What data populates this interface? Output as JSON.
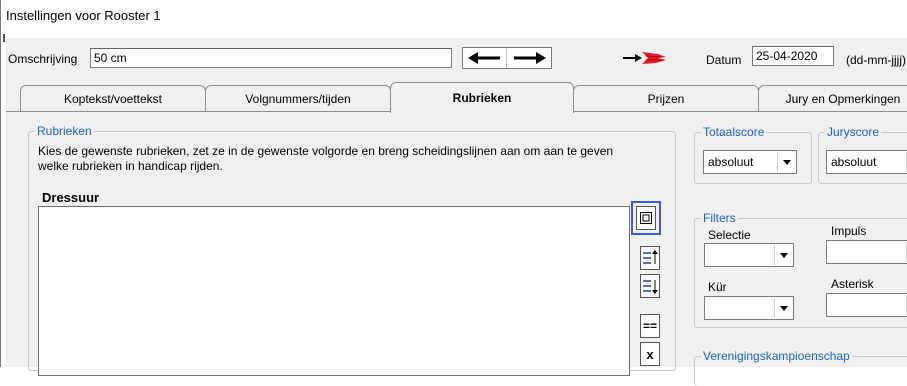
{
  "window": {
    "title": "Instellingen voor Rooster 1"
  },
  "header": {
    "omschrijving_label": "Omschrijving",
    "omschrijving_value": "50 cm",
    "datum_label": "Datum",
    "datum_value": "25-04-2020",
    "datum_format": "(dd-mm-jjjj)"
  },
  "tabs": [
    {
      "label": "Koptekst/voettekst"
    },
    {
      "label": "Volgnummers/tijden"
    },
    {
      "label": "Rubrieken",
      "active": true
    },
    {
      "label": "Prijzen"
    },
    {
      "label": "Jury en Opmerkingen"
    }
  ],
  "rubrieken": {
    "group_title": "Rubrieken",
    "description_line1": "Kies de gewenste rubrieken, zet ze in de gewenste volgorde en breng scheidingslijnen aan om aan te geven",
    "description_line2": "welke rubrieken in handicap rijden.",
    "list_title": "Dressuur",
    "items": []
  },
  "totaalscore": {
    "title": "Totaalscore",
    "value": "absoluut"
  },
  "juryscore": {
    "title": "Juryscore",
    "value": "absoluut"
  },
  "filters": {
    "title": "Filters",
    "selectie_label": "Selectie",
    "selectie_value": "",
    "impuls_label": "Impuls",
    "impuls_value": "",
    "kur_label": "Kür",
    "kur_value": "",
    "asterisk_label": "Asterisk",
    "asterisk_value": ""
  },
  "verenigingskampioenschap": {
    "title": "Verenigingskampioenschap"
  },
  "side_buttons": {
    "separator_glyph": "==",
    "delete_glyph": "x"
  },
  "colors": {
    "group_title": "#1b64b8",
    "focus_border": "#3b5bdb",
    "red_arrow": "#e0202a"
  }
}
